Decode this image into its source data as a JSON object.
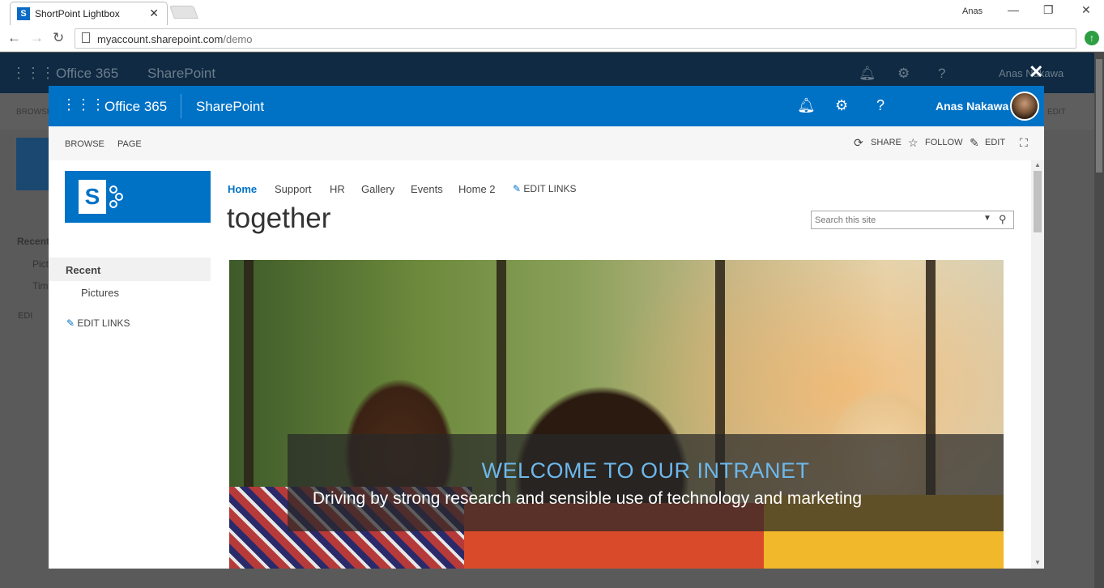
{
  "browser": {
    "tab_title": "ShortPoint Lightbox",
    "tab_favicon": "S",
    "window_user": "Anas",
    "url_host": "myaccount.sharepoint.com",
    "url_path": "/demo"
  },
  "background_page": {
    "app_launcher": "Office 365",
    "product": "SharePoint",
    "user": "Anas Nakawa",
    "ribbon_browse": "BROWSE",
    "ribbon_edit": "EDIT",
    "recent": "Recent",
    "item1": "Pict",
    "item2": "Tim",
    "edit": "EDI"
  },
  "lightbox": {
    "close_glyph": "✕",
    "suite": {
      "app_launcher": "Office 365",
      "product": "SharePoint",
      "user": "Anas Nakawa"
    },
    "ribbon": {
      "browse": "BROWSE",
      "page": "PAGE",
      "share": "SHARE",
      "follow": "FOLLOW",
      "edit": "EDIT"
    },
    "site_logo_letter": "S",
    "top_nav": [
      "Home",
      "Support",
      "HR",
      "Gallery",
      "Events",
      "Home 2"
    ],
    "top_nav_edit": "EDIT LINKS",
    "site_title": "together",
    "search_placeholder": "Search this site",
    "quick_launch": {
      "heading": "Recent",
      "items": [
        "Pictures"
      ],
      "edit": "EDIT LINKS"
    },
    "hero": {
      "heading": "WELCOME TO OUR INTRANET",
      "subheading": "Driving by strong research and sensible use of technology and marketing"
    }
  },
  "colors": {
    "suite_bar": "#0072c6",
    "accent_text": "#6db8ec",
    "dim_overlay": "#555555"
  }
}
